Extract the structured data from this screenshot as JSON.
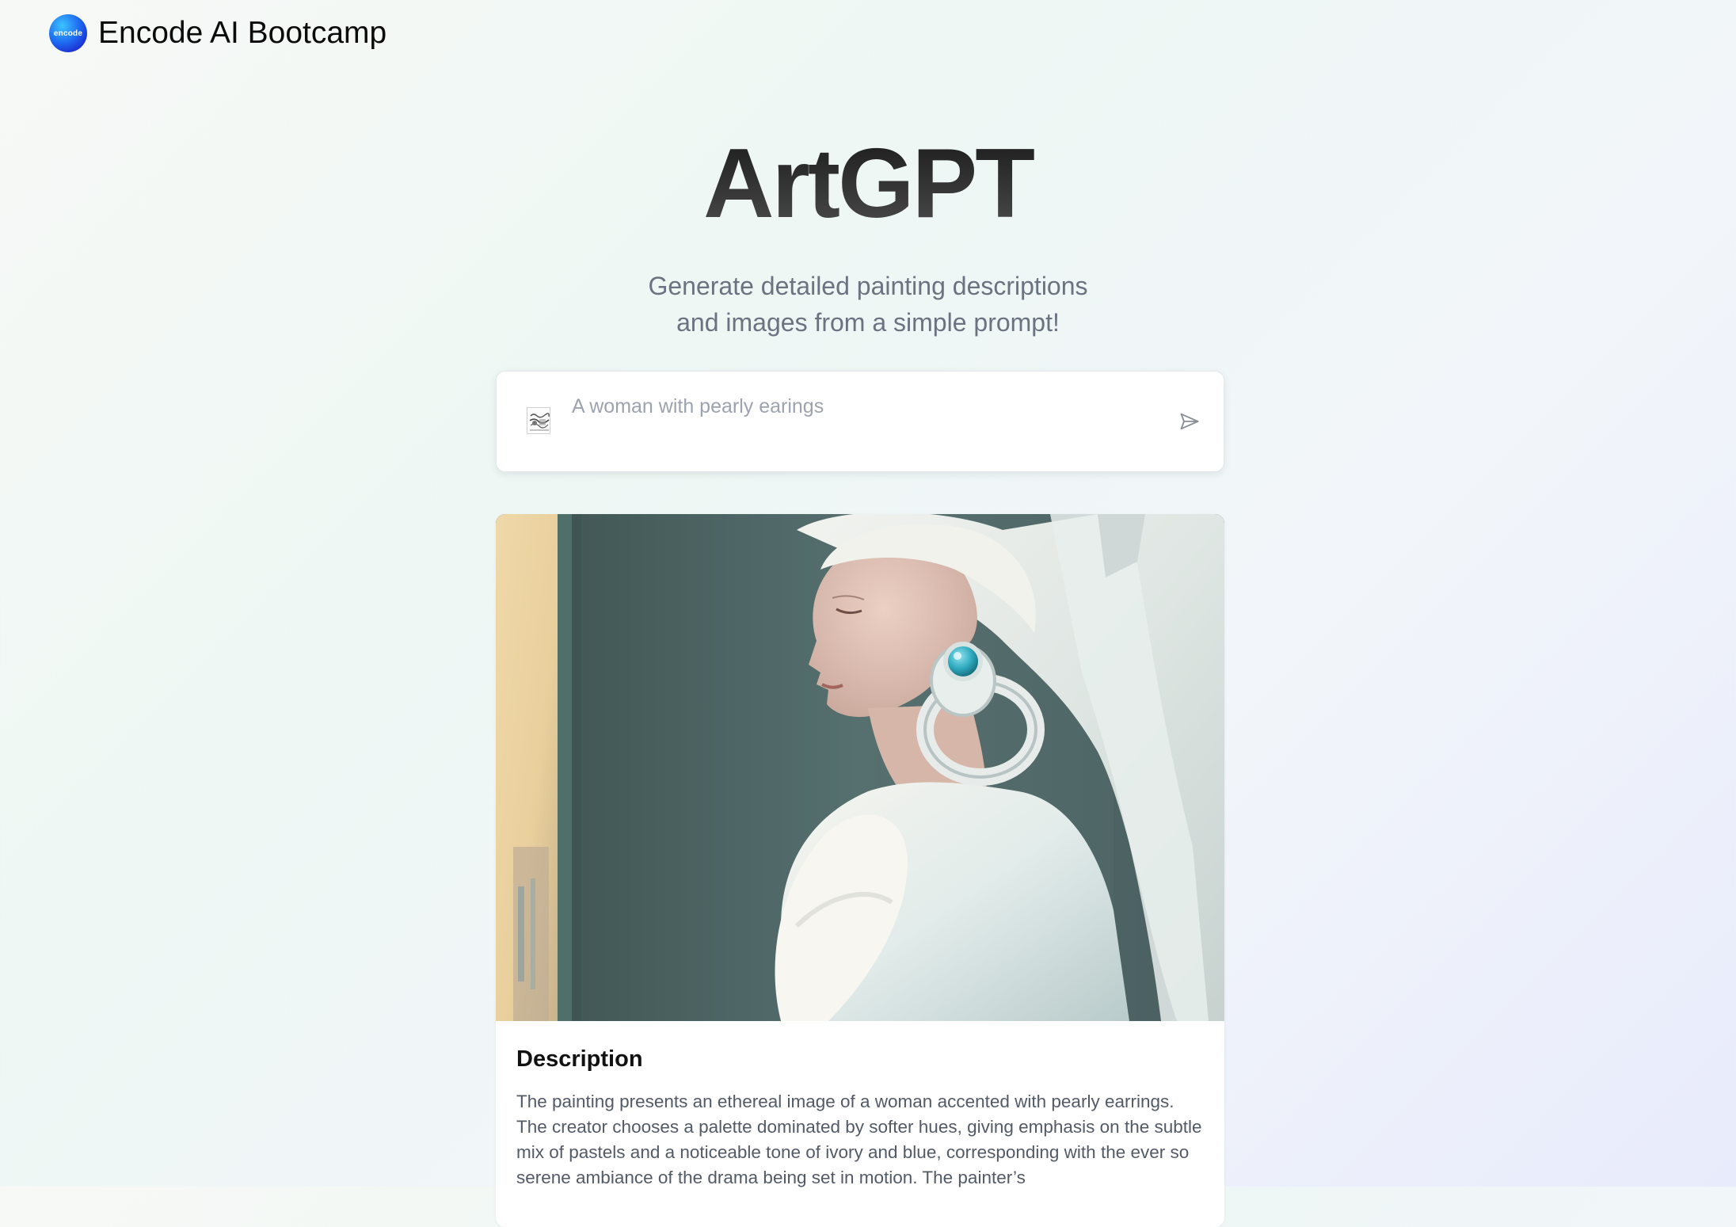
{
  "header": {
    "logo_text": "encode",
    "brand_name": "Encode AI Bootcamp"
  },
  "hero": {
    "title": "ArtGPT",
    "subtitle_line1": "Generate detailed painting descriptions",
    "subtitle_line2": "and images from a simple prompt!"
  },
  "prompt": {
    "value": "",
    "placeholder": "A woman with pearly earings"
  },
  "result": {
    "image_alt": "Generated painting of a woman in a white head covering with a large turquoise earring",
    "description_heading": "Description",
    "description_text": "The painting presents an ethereal image of a woman accented with pearly earrings. The creator chooses a palette dominated by softer hues, giving emphasis on the subtle mix of pastels and a noticeable tone of ivory and blue, corresponding with the ever so serene ambiance of the drama being set in motion. The painter’s"
  },
  "colors": {
    "title_dark": "#2b2b2b",
    "subtitle_gray": "#6b7280",
    "logo_blue": "#1f6ef2",
    "earring_turquoise": "#3bb7c9"
  },
  "icons": {
    "prompt_thumbnail": "image-thumbnail-icon",
    "send": "send-icon"
  }
}
